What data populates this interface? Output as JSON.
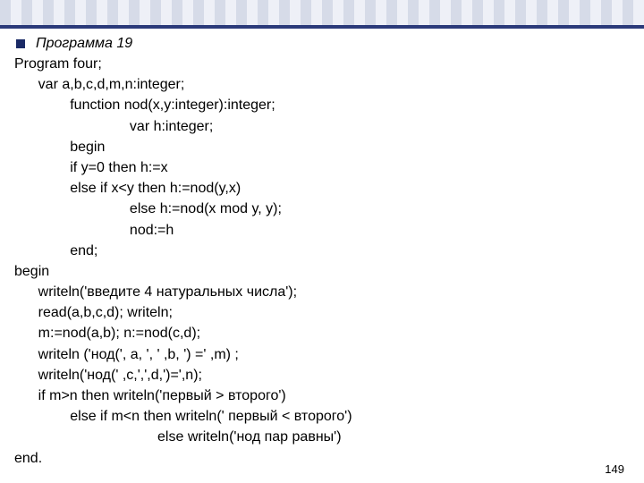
{
  "header": {
    "bullet_title": "Программа 19"
  },
  "code_lines": [
    "Program four;",
    "      var a,b,c,d,m,n:integer;",
    "              function nod(x,y:integer):integer;",
    "                             var h:integer;",
    "              begin",
    "              if y=0 then h:=x",
    "              else if x<y then h:=nod(y,x)",
    "                             else h:=nod(x mod y, y);",
    "                             nod:=h",
    "              end;",
    "begin",
    "      writeln('введите 4 натуральных числа');",
    "      read(a,b,c,d); writeln;",
    "      m:=nod(a,b); n:=nod(c,d);",
    "      writeln ('нод(', a, ', ' ,b, ') =' ,m) ;",
    "      writeln('нод(' ,c,',',d,')=',n);",
    "      if m>n then writeln('первый > второго')",
    "              else if m<n then writeln(' первый < второго')",
    "                                    else writeln('нод пар равны')",
    "end."
  ],
  "page_number": "149"
}
